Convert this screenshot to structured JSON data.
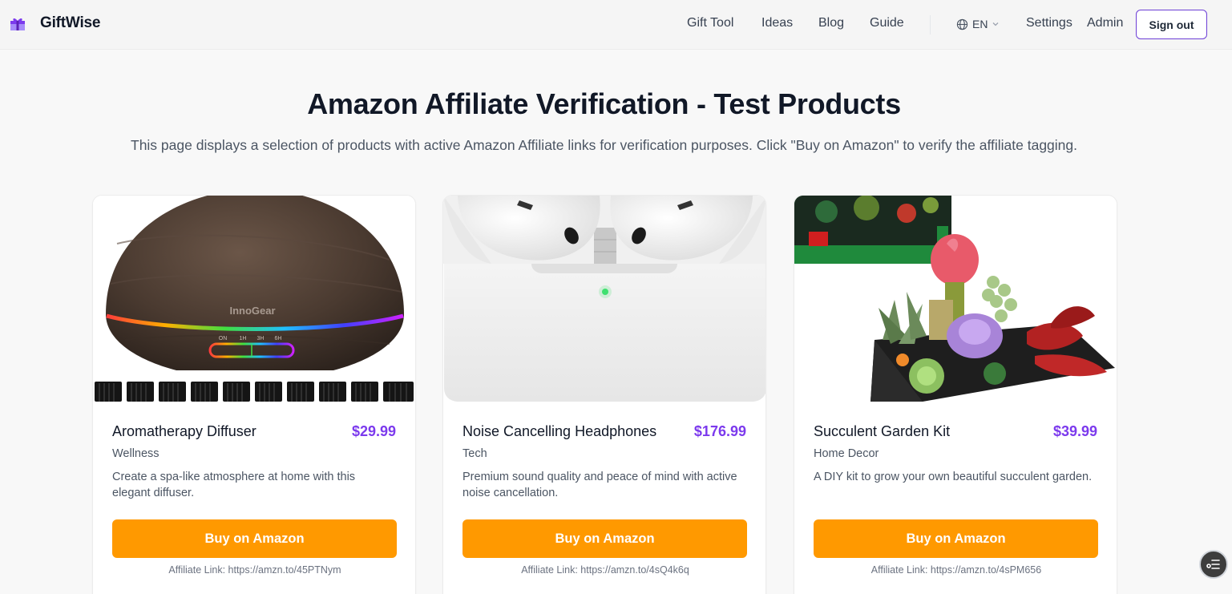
{
  "brand": {
    "name": "GiftWise",
    "logo_icon": "gift-icon"
  },
  "nav": {
    "links": [
      "Gift Tool",
      "Ideas",
      "Blog",
      "Guide"
    ],
    "language": "EN",
    "settings": "Settings",
    "admin": "Admin",
    "sign_out": "Sign out"
  },
  "page": {
    "title": "Amazon Affiliate Verification - Test Products",
    "description": "This page displays a selection of products with active Amazon Affiliate links for verification purposes. Click \"Buy on Amazon\" to verify the affiliate tagging."
  },
  "products": [
    {
      "name": "Aromatherapy Diffuser",
      "price": "$29.99",
      "category": "Wellness",
      "description": "Create a spa-like atmosphere at home with this elegant diffuser.",
      "button": "Buy on Amazon",
      "affiliate": "Affiliate Link: https://amzn.to/45PTNym",
      "image_brand_text": "InnoGear",
      "image_timer_labels": [
        "ON",
        "1H",
        "3H",
        "6H"
      ]
    },
    {
      "name": "Noise Cancelling Headphones",
      "price": "$176.99",
      "category": "Tech",
      "description": "Premium sound quality and peace of mind with active noise cancellation.",
      "button": "Buy on Amazon",
      "affiliate": "Affiliate Link: https://amzn.to/4sQ4k6q"
    },
    {
      "name": "Succulent Garden Kit",
      "price": "$39.99",
      "category": "Home Decor",
      "description": "A DIY kit to grow your own beautiful succulent garden.",
      "button": "Buy on Amazon",
      "affiliate": "Affiliate Link: https://amzn.to/4sPM656"
    }
  ],
  "colors": {
    "accent": "#7c3aed",
    "amazon_orange": "#ff9900"
  },
  "fab_icon": "list-menu-icon"
}
